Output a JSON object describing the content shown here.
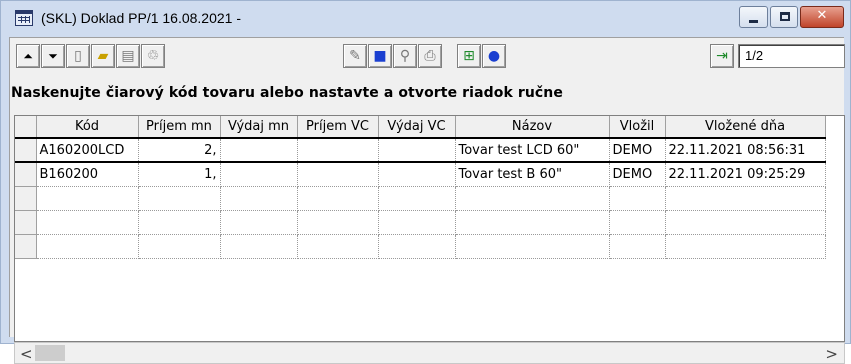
{
  "window": {
    "title": "(SKL) Doklad PP/1 16.08.2021 -",
    "min_glyph": "",
    "max_glyph": "",
    "close_glyph": "✕"
  },
  "toolbar": {
    "page_indicator": "1/2"
  },
  "instruction": "Naskenujte čiarový kód tovaru alebo nastavte a otvorte riadok ručne",
  "grid": {
    "columns": [
      "Kód",
      "Príjem mn",
      "Výdaj mn",
      "Príjem VC",
      "Výdaj VC",
      "Názov",
      "Vložil",
      "Vložené dňa"
    ],
    "rows": [
      [
        "A160200LCD",
        "2,",
        "",
        "",
        "",
        "Tovar test LCD 60\"",
        "DEMO",
        "22.11.2021 08:56:31"
      ],
      [
        "B160200",
        "1,",
        "",
        "",
        "",
        "Tovar test B 60\"",
        "DEMO",
        "22.11.2021 09:25:29"
      ],
      [
        "",
        "",
        "",
        "",
        "",
        "",
        "",
        ""
      ],
      [
        "",
        "",
        "",
        "",
        "",
        "",
        "",
        ""
      ],
      [
        "",
        "",
        "",
        "",
        "",
        "",
        "",
        ""
      ]
    ]
  },
  "scrollbar": {
    "left_arrow": "<",
    "right_arrow": ">"
  }
}
